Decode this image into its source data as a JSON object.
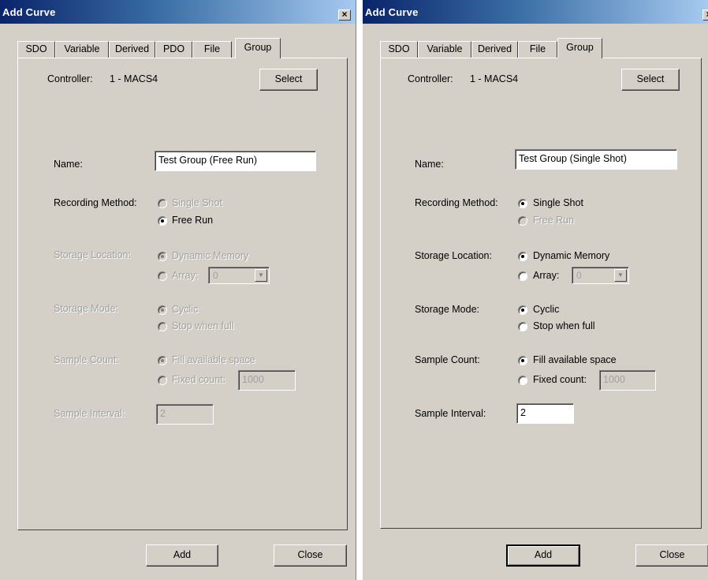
{
  "left": {
    "title": "Add Curve",
    "close_glyph": "×",
    "tabs": [
      "SDO",
      "Variable",
      "Derived",
      "PDO",
      "File",
      "Group"
    ],
    "controller_label": "Controller:",
    "controller_value": "1 - MACS4",
    "select_label": "Select",
    "name_label": "Name:",
    "name_value": "Test Group (Free Run)",
    "recording_label": "Recording Method:",
    "rec_single": "Single Shot",
    "rec_free": "Free Run",
    "storage_label": "Storage Location:",
    "storage_dynamic": "Dynamic Memory",
    "storage_array": "Array:",
    "array_value": "0",
    "mode_label": "Storage Mode:",
    "mode_cyclic": "Cyclic",
    "mode_stop": "Stop when full",
    "count_label": "Sample Count:",
    "count_fill": "Fill available space",
    "count_fixed": "Fixed count:",
    "fixed_value": "1000",
    "interval_label": "Sample Interval:",
    "interval_value": "2",
    "add_label": "Add",
    "close_label": "Close"
  },
  "right": {
    "title": "Add Curve",
    "close_glyph": "×",
    "tabs": [
      "SDO",
      "Variable",
      "Derived",
      "File",
      "Group"
    ],
    "controller_label": "Controller:",
    "controller_value": "1 - MACS4",
    "select_label": "Select",
    "name_label": "Name:",
    "name_value": "Test Group (Single Shot)",
    "recording_label": "Recording Method:",
    "rec_single": "Single Shot",
    "rec_free": "Free Run",
    "storage_label": "Storage Location:",
    "storage_dynamic": "Dynamic Memory",
    "storage_array": "Array:",
    "array_value": "0",
    "mode_label": "Storage Mode:",
    "mode_cyclic": "Cyclic",
    "mode_stop": "Stop when full",
    "count_label": "Sample Count:",
    "count_fill": "Fill available space",
    "count_fixed": "Fixed count:",
    "fixed_value": "1000",
    "interval_label": "Sample Interval:",
    "interval_value": "2",
    "add_label": "Add",
    "close_label": "Close"
  },
  "colors": {
    "dialog_bg": "#d4d0c8",
    "title_start": "#0a246a",
    "title_end": "#a6caf0",
    "disabled_text": "#a0a0a0"
  }
}
